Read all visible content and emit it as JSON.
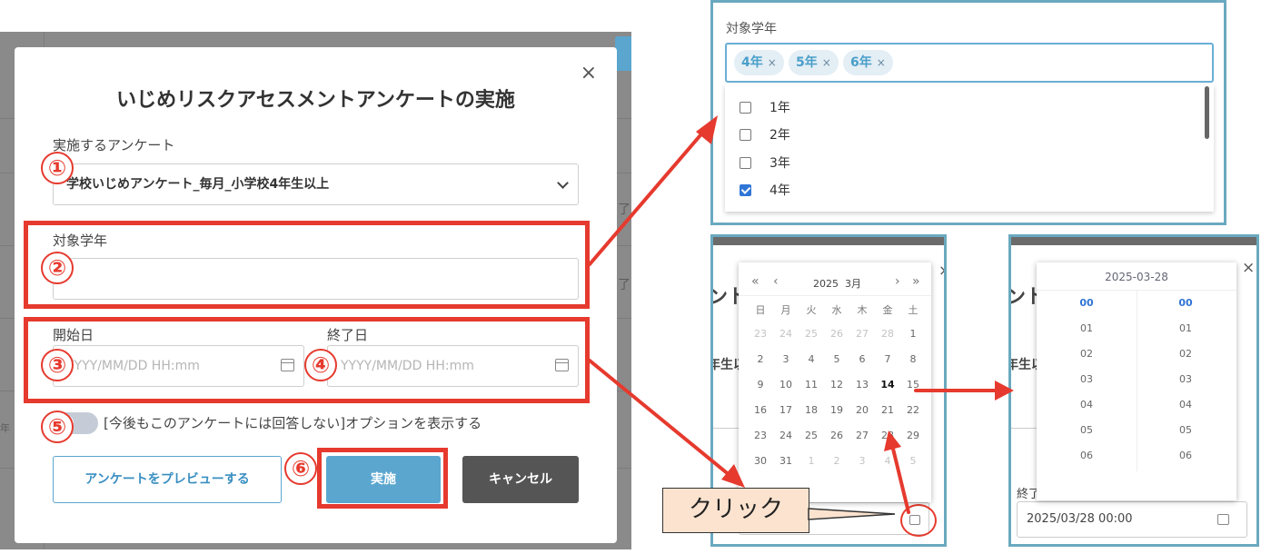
{
  "modal": {
    "title": "いじめリスクアセスメントアンケートの実施",
    "survey_label": "実施するアンケート",
    "survey_value": "学校いじめアンケート_毎月_小学校4年生以上",
    "grade_label": "対象学年",
    "start_label": "開始日",
    "end_label": "終了日",
    "date_placeholder": "YYYY/MM/DD HH:mm",
    "toggle_text": "[今後もこのアンケートには回答しない]オプションを表示する",
    "preview_button": "アンケートをプレビューする",
    "run_button": "実施",
    "cancel_button": "キャンセル",
    "close": "×"
  },
  "annotations": {
    "markers": [
      "①",
      "②",
      "③",
      "④",
      "⑤",
      "⑥"
    ],
    "click_label": "クリック"
  },
  "background": {
    "fragments": [
      "了",
      "了",
      "年"
    ]
  },
  "grade_panel": {
    "label": "対象学年",
    "tags": [
      {
        "text": "4年"
      },
      {
        "text": "5年"
      },
      {
        "text": "6年"
      }
    ],
    "tag_remove": "×",
    "options": [
      {
        "label": "1年",
        "checked": false
      },
      {
        "label": "2年",
        "checked": false
      },
      {
        "label": "3年",
        "checked": false
      },
      {
        "label": "4年",
        "checked": true
      }
    ]
  },
  "calendar_panel": {
    "year": "2025",
    "month": "3月",
    "nav": {
      "prev_year": "«",
      "prev_month": "‹",
      "next_month": "›",
      "next_year": "»"
    },
    "weekdays": [
      "日",
      "月",
      "火",
      "水",
      "木",
      "金",
      "土"
    ],
    "weeks": [
      [
        "23",
        "24",
        "25",
        "26",
        "27",
        "28",
        "1"
      ],
      [
        "2",
        "3",
        "4",
        "5",
        "6",
        "7",
        "8"
      ],
      [
        "9",
        "10",
        "11",
        "12",
        "13",
        "14",
        "15"
      ],
      [
        "16",
        "17",
        "18",
        "19",
        "20",
        "21",
        "22"
      ],
      [
        "23",
        "24",
        "25",
        "26",
        "27",
        "28",
        "29"
      ],
      [
        "30",
        "31",
        "1",
        "2",
        "3",
        "4",
        "5"
      ]
    ],
    "today": "14",
    "bg_text": "ント",
    "bg_text2": "年生以",
    "close": "×"
  },
  "time_panel": {
    "date_header": "2025-03-28",
    "hours": [
      "00",
      "01",
      "02",
      "03",
      "04",
      "05",
      "06"
    ],
    "minutes": [
      "00",
      "01",
      "02",
      "03",
      "04",
      "05",
      "06"
    ],
    "bg_text": "ント",
    "bg_text2": "年生以",
    "end_label_partial": "終了",
    "end_value": "2025/03/28 00:00",
    "close": "×"
  },
  "colors": {
    "accent": "#5aa6cf",
    "annotation_red": "#e63a2e",
    "panel_border": "#6aa9bf",
    "tag_bg": "#e3eef5",
    "checkbox_on": "#2f75d6",
    "callout_bg": "#fbe3cf"
  }
}
